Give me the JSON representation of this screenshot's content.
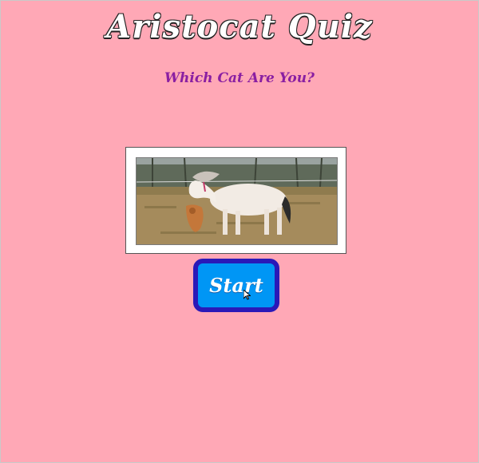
{
  "page": {
    "title": "Aristocat Quiz",
    "subtitle": "Which Cat Are You?"
  },
  "hero_image": {
    "icon": "pony-photo"
  },
  "start_button": {
    "label": "Start"
  },
  "colors": {
    "background": "#ffa8b6",
    "title_fill": "#ffffff",
    "subtitle": "#8a1fa2",
    "button_fill": "#0096f5",
    "button_border": "#2a19b8"
  }
}
